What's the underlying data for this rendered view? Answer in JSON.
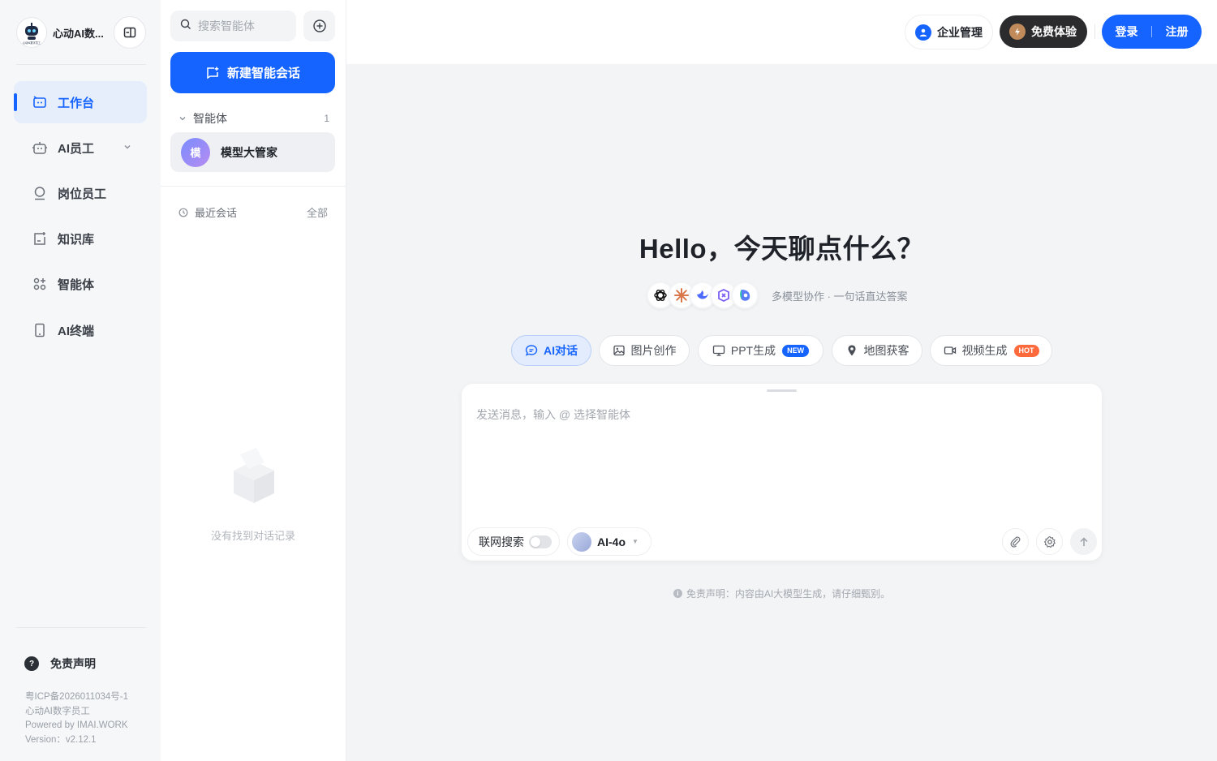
{
  "app": {
    "name": "心动AI数...",
    "logo_caption": "心动AI数字员工"
  },
  "nav": {
    "items": [
      {
        "label": "工作台",
        "icon": "workbench-icon",
        "active": true
      },
      {
        "label": "AI员工",
        "icon": "robot-icon",
        "has_submenu": true
      },
      {
        "label": "岗位员工",
        "icon": "person-icon"
      },
      {
        "label": "知识库",
        "icon": "knowledge-icon"
      },
      {
        "label": "智能体",
        "icon": "agents-grid-icon"
      },
      {
        "label": "AI终端",
        "icon": "tablet-icon"
      }
    ],
    "disclaimer_label": "免责声明",
    "footer": {
      "icp": "粤ICP备2026011034号-1",
      "product": "心动AI数字员工",
      "powered": "Powered by IMAI.WORK",
      "version": "Version：v2.12.1"
    }
  },
  "panel": {
    "search_placeholder": "搜索智能体",
    "new_chat_label": "新建智能会话",
    "agents_section": {
      "label": "智能体",
      "count": "1"
    },
    "agents": [
      {
        "avatar_text": "模",
        "name": "模型大管家"
      }
    ],
    "recent_label": "最近会话",
    "recent_all": "全部",
    "empty_text": "没有找到对话记录"
  },
  "topbar": {
    "enterprise_label": "企业管理",
    "trial_label": "免费体验",
    "login_label": "登录",
    "register_label": "注册"
  },
  "main": {
    "greeting": "Hello，今天聊点什么？",
    "model_icons": [
      "openai-icon",
      "claude-icon",
      "deepseek-icon",
      "kimi-icon",
      "doubao-icon"
    ],
    "tagline": "多模型协作 · 一句话直达答案",
    "tabs": [
      {
        "label": "AI对话",
        "icon": "chat-icon",
        "active": true
      },
      {
        "label": "图片创作",
        "icon": "image-icon"
      },
      {
        "label": "PPT生成",
        "icon": "monitor-icon",
        "badge": "NEW"
      },
      {
        "label": "地图获客",
        "icon": "map-pin-icon"
      },
      {
        "label": "视频生成",
        "icon": "video-icon",
        "badge": "HOT"
      }
    ],
    "composer": {
      "placeholder": "发送消息，输入 @ 选择智能体",
      "web_search_label": "联网搜索",
      "web_search_on": false,
      "model_label": "AI-4o"
    },
    "legal_text": "免责声明：内容由AI大模型生成，请仔细甄别。"
  },
  "colors": {
    "accent": "#1664ff",
    "nav_bg": "#f6f7f9",
    "main_bg": "#f3f4f6",
    "dark_button": "#2b2b2d",
    "hot_badge": "#ff6a3d"
  }
}
